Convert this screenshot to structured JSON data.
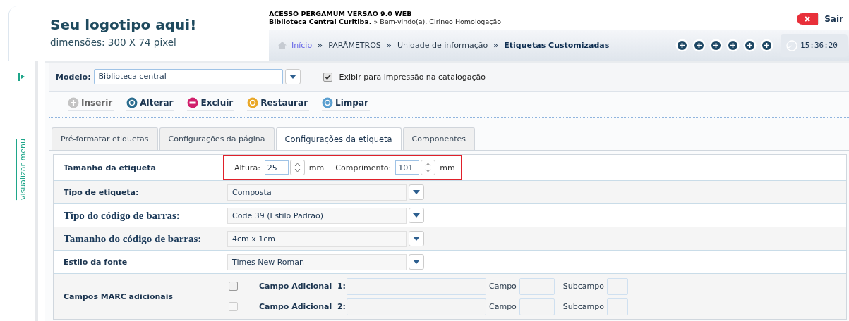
{
  "header": {
    "logo_title": "Seu logotipo aqui!",
    "logo_subtitle": "dimensões: 300 X 74 pixel",
    "system_title": "ACESSO PERGAMUM VERSAO 9.0 WEB",
    "library": "Biblioteca Central Curitiba.",
    "welcome": "» Bem-vindo(a), Cirineo Homologação",
    "logout": "Sair",
    "clock": "15:36:20"
  },
  "breadcrumb": [
    {
      "label": "Início",
      "link": true,
      "current": false
    },
    {
      "label": "PARÂMETROS",
      "link": false,
      "current": false
    },
    {
      "label": "Unidade de informação",
      "link": false,
      "current": false
    },
    {
      "label": "Etiquetas Customizadas",
      "link": false,
      "current": true
    }
  ],
  "breadcrumb_separator": "»",
  "sidebar": {
    "toggle_label": "visualizar menu"
  },
  "model": {
    "label": "Modelo:",
    "value": "Biblioteca central",
    "print_option": {
      "label": "Exibir para impressão na catalogação",
      "checked": true
    }
  },
  "actions": [
    {
      "label": "Inserir",
      "kind": "insert",
      "disabled": true
    },
    {
      "label": "Alterar",
      "kind": "edit",
      "disabled": false
    },
    {
      "label": "Excluir",
      "kind": "delete",
      "disabled": false
    },
    {
      "label": "Restaurar",
      "kind": "restore",
      "disabled": false
    },
    {
      "label": "Limpar",
      "kind": "clear",
      "disabled": false
    }
  ],
  "tabs": [
    {
      "label": "Pré-formatar etiquetas",
      "selected": false
    },
    {
      "label": "Configurações da página",
      "selected": false
    },
    {
      "label": "Configurações da etiqueta",
      "selected": true
    },
    {
      "label": "Componentes",
      "selected": false
    }
  ],
  "rows": [
    {
      "kind": "size",
      "label": "Tamanho da etiqueta",
      "serif_label": false,
      "highlighted": true,
      "height_label": "Altura:",
      "height_value": "25",
      "width_label": "Comprimento:",
      "width_value": "101",
      "height_unit": "mm",
      "width_unit": "mm"
    },
    {
      "kind": "select",
      "label": "Tipo de etiqueta:",
      "serif_label": false,
      "value": "Composta"
    },
    {
      "kind": "select",
      "label": "Tipo do código de barras:",
      "serif_label": true,
      "value": "Code 39 (Estilo Padrão)"
    },
    {
      "kind": "select",
      "label": "Tamanho do código de barras:",
      "serif_label": true,
      "value": "4cm x 1cm"
    },
    {
      "kind": "select",
      "label": "Estilo da fonte",
      "serif_label": false,
      "value": "Times New Roman"
    },
    {
      "kind": "marc",
      "label": "Campos MARC adicionais",
      "serif_label": false,
      "fields": [
        {
          "label": "Campo Adicional  1:",
          "checked": false,
          "disabled": false,
          "campo_label": "Campo",
          "subcampo_label": "Subcampo"
        },
        {
          "label": "Campo Adicional  2:",
          "checked": false,
          "disabled": true,
          "campo_label": "Campo",
          "subcampo_label": "Subcampo"
        }
      ]
    }
  ]
}
